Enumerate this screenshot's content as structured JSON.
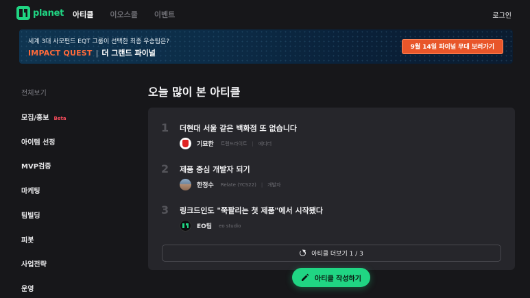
{
  "header": {
    "logo_text": "planet",
    "nav": [
      {
        "label": "아티클",
        "active": true
      },
      {
        "label": "이오스쿨",
        "active": false
      },
      {
        "label": "이벤트",
        "active": false
      }
    ],
    "login_label": "로그인"
  },
  "banner": {
    "line1": "세계 3대 사모펀드 EQT 그룹이 선택한  최종 우승팀은?",
    "brand": "IMPACT QUEST",
    "divider": "|",
    "subtitle": "더 그랜드 파이널",
    "button_label": "9월 14일 파이널 무대 보러가기"
  },
  "sidebar": {
    "items": [
      {
        "label": "전체보기",
        "dim": true
      },
      {
        "label": "모집/홍보",
        "badge": "Beta"
      },
      {
        "label": "아이템 선정"
      },
      {
        "label": "MVP검증"
      },
      {
        "label": "마케팅"
      },
      {
        "label": "팀빌딩"
      },
      {
        "label": "피봇"
      },
      {
        "label": "사업전략"
      },
      {
        "label": "운영"
      }
    ]
  },
  "main": {
    "title": "오늘 많이 본 아티클",
    "articles": [
      {
        "rank": "1",
        "title": "더현대 서울 같은 백화점 또 없습니다",
        "author": "기묘한",
        "company": "트렌드라이트",
        "separator": "|",
        "role": "에디터"
      },
      {
        "rank": "2",
        "title": "제품 중심 개발자 되기",
        "author": "한정수",
        "company": "Relate (YCS22)",
        "separator": "|",
        "role": "개발자"
      },
      {
        "rank": "3",
        "title": "링크드인도 \"쭉팔리는 첫 제품\"에서 시작됐다",
        "author": "EO팀",
        "company": "eo studio",
        "separator": "",
        "role": ""
      }
    ],
    "more_label": "아티클 더보기 1 / 3",
    "write_label": "아티클 작성하기"
  },
  "colors": {
    "accent": "#20d583",
    "banner_button": "#e8562a",
    "background": "#17171a",
    "card": "#26262b"
  }
}
